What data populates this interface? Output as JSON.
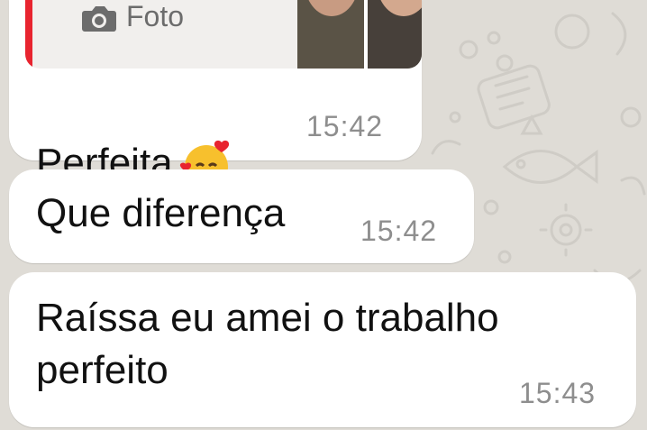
{
  "reply": {
    "label": "Foto",
    "icon": "camera-icon",
    "accent": "#e8242f"
  },
  "messages": [
    {
      "text": "Perfeita",
      "emoji": "smiling-face-with-hearts",
      "time": "15:42"
    },
    {
      "text": "Que diferença",
      "time": "15:42"
    },
    {
      "text": "Raíssa eu amei o trabalho\nperfeito",
      "time": "15:43"
    }
  ],
  "colors": {
    "chat_background": "#dfdcd6",
    "bubble": "#ffffff",
    "timestamp": "#8e8e8e"
  }
}
